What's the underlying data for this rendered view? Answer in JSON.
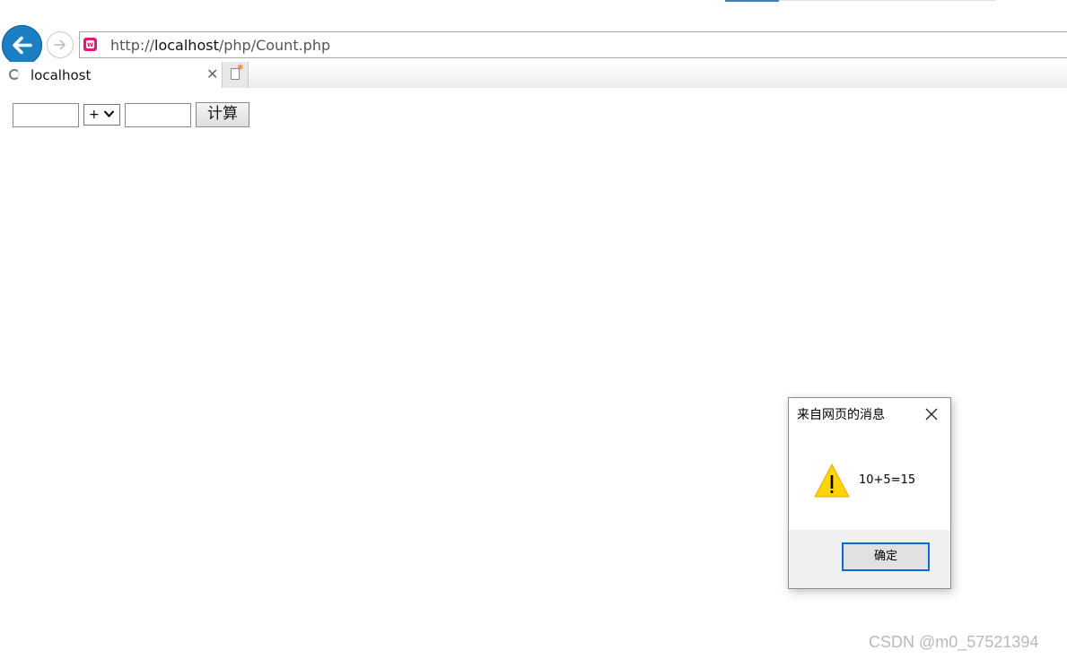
{
  "browser": {
    "back_icon": "back-arrow-icon",
    "forward_icon": "forward-arrow-icon",
    "address": {
      "site_icon": "wamp-site-icon",
      "url_prefix": "http://",
      "url_host": "localhost",
      "url_path": "/php/Count.php"
    },
    "tab": {
      "title": "localhost",
      "close_label": "✕",
      "loading_icon": "loading-spinner-icon"
    },
    "new_tab_icon": "new-tab-icon"
  },
  "page": {
    "first_input_value": "",
    "operator_selected": "+",
    "second_input_value": "",
    "calc_button_label": "计算"
  },
  "dialog": {
    "title": "来自网页的消息",
    "message": "10+5=15",
    "ok_label": "确定",
    "icon": "warning-icon"
  },
  "watermark": "CSDN @m0_57521394",
  "colors": {
    "back_button": "#1b7fc4",
    "ok_button_border": "#0b6ad0",
    "warning_fill": "#ffd400"
  }
}
